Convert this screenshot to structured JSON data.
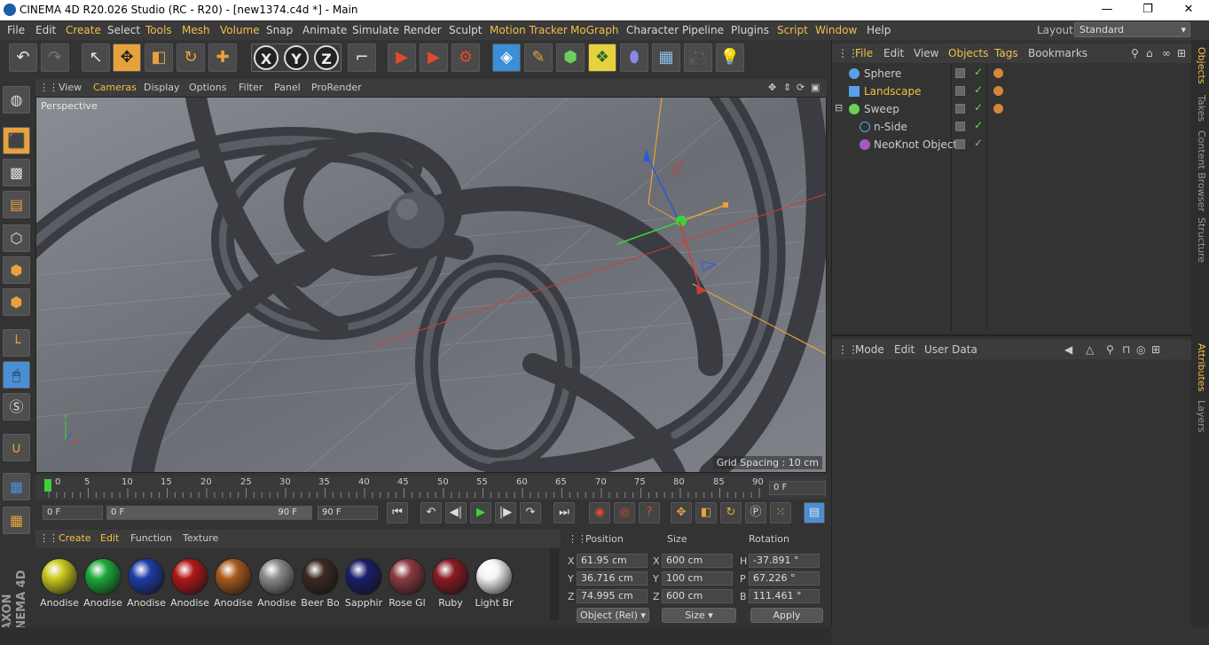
{
  "window": {
    "title": "CINEMA 4D R20.026 Studio (RC - R20) - [new1374.c4d *] - Main",
    "minimize": "—",
    "maximize": "❐",
    "close": "✕"
  },
  "menubar": {
    "items": [
      "File",
      "Edit",
      "Create",
      "Select",
      "Tools",
      "Mesh",
      "Volume",
      "Snap",
      "Animate",
      "Simulate",
      "Render",
      "Sculpt",
      "Motion Tracker",
      "MoGraph",
      "Character",
      "Pipeline",
      "Plugins",
      "Script",
      "Window",
      "Help"
    ],
    "layout_label": "Layout:",
    "layout_value": "Standard"
  },
  "viewport": {
    "menu": [
      "View",
      "Cameras",
      "Display",
      "Options",
      "Filter",
      "Panel",
      "ProRender"
    ],
    "camera_label": "Perspective",
    "grid_spacing": "Grid Spacing : 10 cm"
  },
  "timeline": {
    "ticks": [
      "0",
      "5",
      "10",
      "15",
      "20",
      "25",
      "30",
      "35",
      "40",
      "45",
      "50",
      "55",
      "60",
      "65",
      "70",
      "75",
      "80",
      "85",
      "90"
    ],
    "current_frame": "0 F"
  },
  "transport": {
    "start_frame": "0 F",
    "range_start": "0 F",
    "range_end": "90 F",
    "end_frame": "90 F"
  },
  "material_manager": {
    "menu": [
      "Create",
      "Edit",
      "Function",
      "Texture"
    ],
    "materials": [
      {
        "name": "Anodise",
        "color": "#c8c81e"
      },
      {
        "name": "Anodise",
        "color": "#1ea83a"
      },
      {
        "name": "Anodise",
        "color": "#1e3ca8"
      },
      {
        "name": "Anodise",
        "color": "#b01818"
      },
      {
        "name": "Anodise",
        "color": "#a85a1e"
      },
      {
        "name": "Anodise",
        "color": "#8a8a8a"
      },
      {
        "name": "Beer Bo",
        "color": "#3a2a22"
      },
      {
        "name": "Sapphir",
        "color": "#1a1e6a"
      },
      {
        "name": "Rose Gl",
        "color": "#8a3a40"
      },
      {
        "name": "Ruby",
        "color": "#8a1a24"
      },
      {
        "name": "Light Br",
        "color": "#f4f4f4"
      }
    ]
  },
  "coordinates": {
    "headers": [
      "Position",
      "Size",
      "Rotation"
    ],
    "rows": [
      {
        "axis": "X",
        "pos": "61.95 cm",
        "size_axis": "X",
        "size": "600 cm",
        "rot_axis": "H",
        "rot": "-37.891 °"
      },
      {
        "axis": "Y",
        "pos": "36.716 cm",
        "size_axis": "Y",
        "size": "100 cm",
        "rot_axis": "P",
        "rot": "67.226 °"
      },
      {
        "axis": "Z",
        "pos": "74.995 cm",
        "size_axis": "Z",
        "size": "600 cm",
        "rot_axis": "B",
        "rot": "111.461 °"
      }
    ],
    "mode_select": "Object (Rel)",
    "size_select": "Size",
    "apply": "Apply"
  },
  "object_manager": {
    "menu": [
      "File",
      "Edit",
      "View",
      "Objects",
      "Tags",
      "Bookmarks"
    ],
    "objects": [
      {
        "name": "Sphere",
        "color": "#5aa0e6"
      },
      {
        "name": "Landscape",
        "color": "#5aa0e6"
      },
      {
        "name": "Sweep",
        "color": "#6ad05a"
      },
      {
        "name": "n-Side",
        "color": "#5aa0e6"
      },
      {
        "name": "NeoKnot Object",
        "color": "#a05ac0"
      }
    ]
  },
  "attribute_manager": {
    "menu": [
      "Mode",
      "Edit",
      "User Data"
    ]
  },
  "side_tabs": [
    "Objects",
    "Takes",
    "Content Browser",
    "Structure",
    "Attributes",
    "Layers"
  ]
}
